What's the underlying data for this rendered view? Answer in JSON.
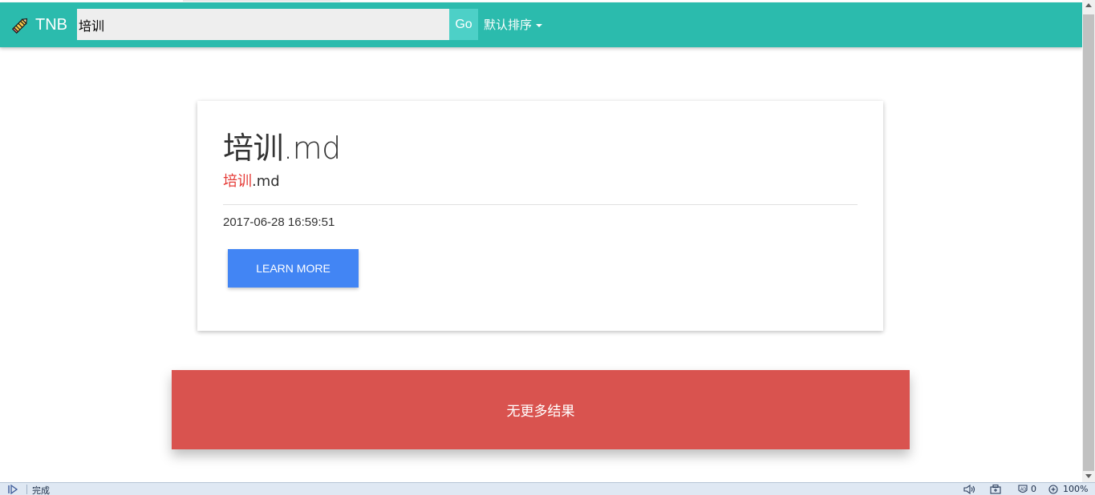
{
  "navbar": {
    "brand": "TNB",
    "search_value": "培训",
    "go_label": "Go",
    "sort_label": "默认排序"
  },
  "result": {
    "title": "培训.md",
    "subtitle_highlight": "培训",
    "subtitle_rest": ".md",
    "date": "2017-06-28 16:59:51",
    "button_label": "LEARN MORE"
  },
  "no_more_text": "无更多结果",
  "statusbar": {
    "status": "完成",
    "blocked_count": "0",
    "zoom": "100%"
  },
  "colors": {
    "navbar": "#2bbbad",
    "go_button": "#4dd0c7",
    "learn_button": "#4285f4",
    "highlight": "#e53935",
    "no_more_bg": "#d9534f"
  },
  "icons": {
    "brand": "pencil-icon",
    "sort": "caret-down-icon",
    "status_left": "play-forward-icon",
    "sound": "speaker-icon",
    "network": "network-icon",
    "block": "adblock-icon",
    "zoom": "zoom-in-icon"
  }
}
